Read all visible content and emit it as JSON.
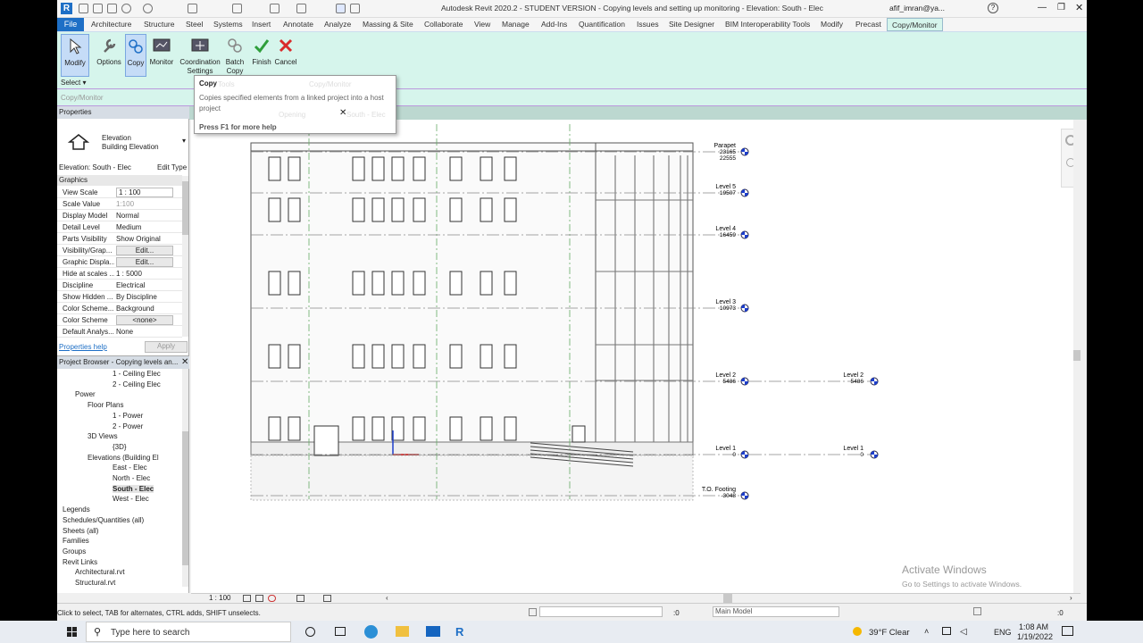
{
  "qat": {
    "title": "Autodesk Revit 2020.2 - STUDENT VERSION - Copying levels and setting up monitoring - Elevation: South - Elec",
    "user": "afif_imran@ya..."
  },
  "tabs": [
    "File",
    "Architecture",
    "Structure",
    "Steel",
    "Systems",
    "Insert",
    "Annotate",
    "Analyze",
    "Massing & Site",
    "Collaborate",
    "View",
    "Manage",
    "Add-Ins",
    "Quantification",
    "Issues",
    "Site Designer",
    "BIM Interoperability Tools",
    "Modify",
    "Precast",
    "Copy/Monitor"
  ],
  "ribbon": {
    "modify": "Modify",
    "options": "Options",
    "copy": "Copy",
    "monitor": "Monitor",
    "coord": "Coordination Settings",
    "batch": "Batch Copy",
    "finish": "Finish",
    "cancel": "Cancel"
  },
  "optbar": {
    "select": "Select ▾",
    "panel": "Copy/Monitor"
  },
  "tooltip": {
    "title": "Copy",
    "desc": "Copies specified elements from a linked project into a host project",
    "help": "Press F1 for more help",
    "bg_tools": "Tools",
    "bg_cm": "Copy/Monitor",
    "bg_opening": "Opening",
    "bg_tab": "South - Elec"
  },
  "props": {
    "header": "Properties",
    "type1": "Elevation",
    "type2": "Building Elevation",
    "selector": "Elevation: South - Elec",
    "edit_type": "Edit Type",
    "group": "Graphics",
    "help": "Properties help",
    "apply": "Apply",
    "rows": [
      {
        "k": "View Scale",
        "v": "1 : 100"
      },
      {
        "k": "Scale Value",
        "v": "1:100"
      },
      {
        "k": "Display Model",
        "v": "Normal"
      },
      {
        "k": "Detail Level",
        "v": "Medium"
      },
      {
        "k": "Parts Visibility",
        "v": "Show Original"
      },
      {
        "k": "Visibility/Grap...",
        "v": "Edit..."
      },
      {
        "k": "Graphic Displa...",
        "v": "Edit..."
      },
      {
        "k": "Hide at scales ...",
        "v": "1 : 5000"
      },
      {
        "k": "Discipline",
        "v": "Electrical"
      },
      {
        "k": "Show Hidden ...",
        "v": "By Discipline"
      },
      {
        "k": "Color Scheme...",
        "v": "Background"
      },
      {
        "k": "Color Scheme",
        "v": "<none>"
      },
      {
        "k": "Default Analys...",
        "v": "None"
      }
    ]
  },
  "browser": {
    "header": "Project Browser - Copying levels an...",
    "items": [
      {
        "t": "1 - Ceiling Elec",
        "l": 3
      },
      {
        "t": "2 - Ceiling Elec",
        "l": 3
      },
      {
        "t": "Power",
        "l": 1
      },
      {
        "t": "Floor Plans",
        "l": 2
      },
      {
        "t": "1 - Power",
        "l": 3
      },
      {
        "t": "2 - Power",
        "l": 3
      },
      {
        "t": "3D Views",
        "l": 2
      },
      {
        "t": "{3D}",
        "l": 3
      },
      {
        "t": "Elevations (Building El",
        "l": 2
      },
      {
        "t": "East - Elec",
        "l": 3
      },
      {
        "t": "North - Elec",
        "l": 3
      },
      {
        "t": "South - Elec",
        "l": 3
      },
      {
        "t": "West - Elec",
        "l": 3
      },
      {
        "t": "Legends",
        "l": 0
      },
      {
        "t": "Schedules/Quantities (all)",
        "l": 0
      },
      {
        "t": "Sheets (all)",
        "l": 0
      },
      {
        "t": "Families",
        "l": 0
      },
      {
        "t": "Groups",
        "l": 0
      },
      {
        "t": "Revit Links",
        "l": 0
      },
      {
        "t": "Architectural.rvt",
        "l": 1
      },
      {
        "t": "Structural.rvt",
        "l": 1
      }
    ]
  },
  "levels": [
    {
      "name": "Parapet",
      "elev": "23165",
      "extra": "22555"
    },
    {
      "name": "Level 5",
      "elev": "19507"
    },
    {
      "name": "Level 4",
      "elev": "16459"
    },
    {
      "name": "Level 3",
      "elev": "10973"
    },
    {
      "name": "Level 2",
      "elev": "5486"
    },
    {
      "name": "Level 1",
      "elev": "0"
    },
    {
      "name": "T.O. Footing",
      "elev": "-3048"
    }
  ],
  "linked_levels": [
    {
      "name": "Level 2",
      "elev": "5486"
    },
    {
      "name": "Level 1",
      "elev": "0"
    }
  ],
  "viewctl": {
    "scale": "1 : 100"
  },
  "status": {
    "hint": "Click to select, TAB for alternates, CTRL adds, SHIFT unselects.",
    "model": "Main Model",
    "zero1": ":0",
    "zero2": ":0"
  },
  "watermark": {
    "title": "Activate Windows",
    "sub": "Go to Settings to activate Windows."
  },
  "taskbar": {
    "search": "Type here to search",
    "weather": "39°F  Clear",
    "lang": "ENG",
    "time": "1:08 AM",
    "date": "1/19/2022"
  },
  "colors": {
    "ribbon": "#d6f5ec",
    "accent": "#1e6fc6"
  }
}
